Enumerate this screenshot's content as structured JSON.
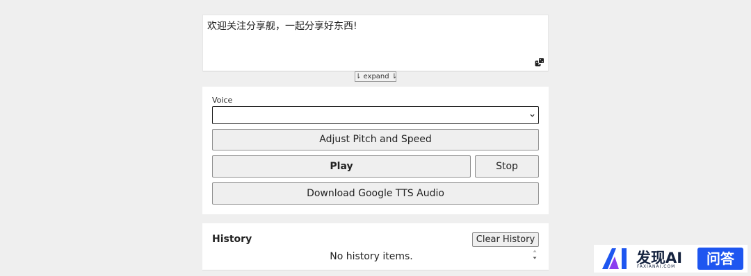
{
  "text_area": {
    "value": "欢迎关注分享舰，一起分享好东西!"
  },
  "expand": {
    "label": "⇂ expand ⇂"
  },
  "voice": {
    "label": "Voice",
    "selected": ""
  },
  "buttons": {
    "pitch": "Adjust Pitch and Speed",
    "play": "Play",
    "stop": "Stop",
    "download": "Download Google TTS Audio"
  },
  "history": {
    "title": "History",
    "clear": "Clear History",
    "empty": "No history items."
  },
  "watermark": {
    "name": "发现AI",
    "sub": "FAXIANAI.COM",
    "tag": "问答"
  },
  "colors": {
    "background": "#efefef",
    "watermark_blue": "#1e56f0",
    "watermark_navy": "#15233f"
  },
  "icons": {
    "random": "dice-icon",
    "select": "chevron-down-icon"
  }
}
